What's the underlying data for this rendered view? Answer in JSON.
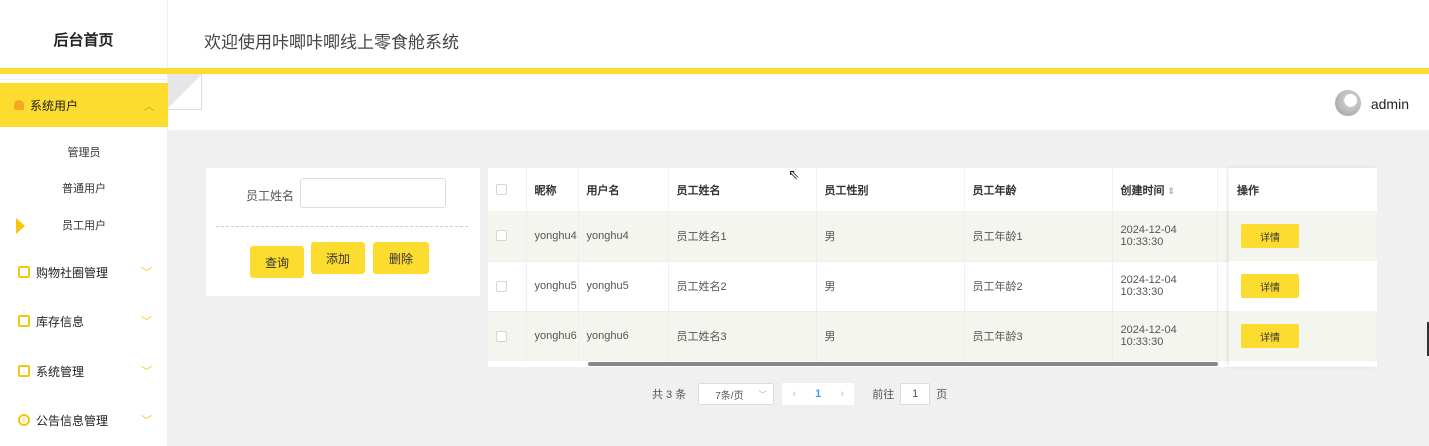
{
  "sidebar": {
    "brand": "后台首页",
    "active_menu": "系统用户",
    "submenu": [
      "管理员",
      "普通用户",
      "员工用户"
    ],
    "menus": [
      {
        "label": "购物社圈管理",
        "icon": "square-icon"
      },
      {
        "label": "库存信息",
        "icon": "square-icon"
      },
      {
        "label": "系统管理",
        "icon": "image-icon"
      },
      {
        "label": "公告信息管理",
        "icon": "info-icon"
      }
    ]
  },
  "header": {
    "title": "欢迎使用咔唧咔唧线上零食舱系统"
  },
  "topbar": {
    "username": "admin"
  },
  "search": {
    "label": "员工姓名",
    "value": "",
    "buttons": {
      "query": "查询",
      "add": "添加",
      "delete": "删除"
    }
  },
  "table": {
    "columns": [
      "昵称",
      "用户名",
      "员工姓名",
      "员工性别",
      "员工年龄",
      "创建时间",
      "操作"
    ],
    "sort_glyph": "⇕",
    "rows": [
      {
        "nickname": "yonghu4",
        "username": "yonghu4",
        "name": "员工姓名1",
        "gender": "男",
        "age": "员工年龄1",
        "created": "2024-12-04 10:33:30",
        "action": "详情"
      },
      {
        "nickname": "yonghu5",
        "username": "yonghu5",
        "name": "员工姓名2",
        "gender": "男",
        "age": "员工年龄2",
        "created": "2024-12-04 10:33:30",
        "action": "详情"
      },
      {
        "nickname": "yonghu6",
        "username": "yonghu6",
        "name": "员工姓名3",
        "gender": "男",
        "age": "员工年龄3",
        "created": "2024-12-04 10:33:30",
        "action": "详情"
      }
    ]
  },
  "pagination": {
    "total": "共 3 条",
    "page_size": "7条/页",
    "current": "1",
    "goto_label": "前往",
    "goto_value": "1",
    "goto_unit": "页"
  },
  "colors": {
    "accent": "#fcdc2e",
    "icon": "#f2c811",
    "page_link": "#409eff"
  }
}
